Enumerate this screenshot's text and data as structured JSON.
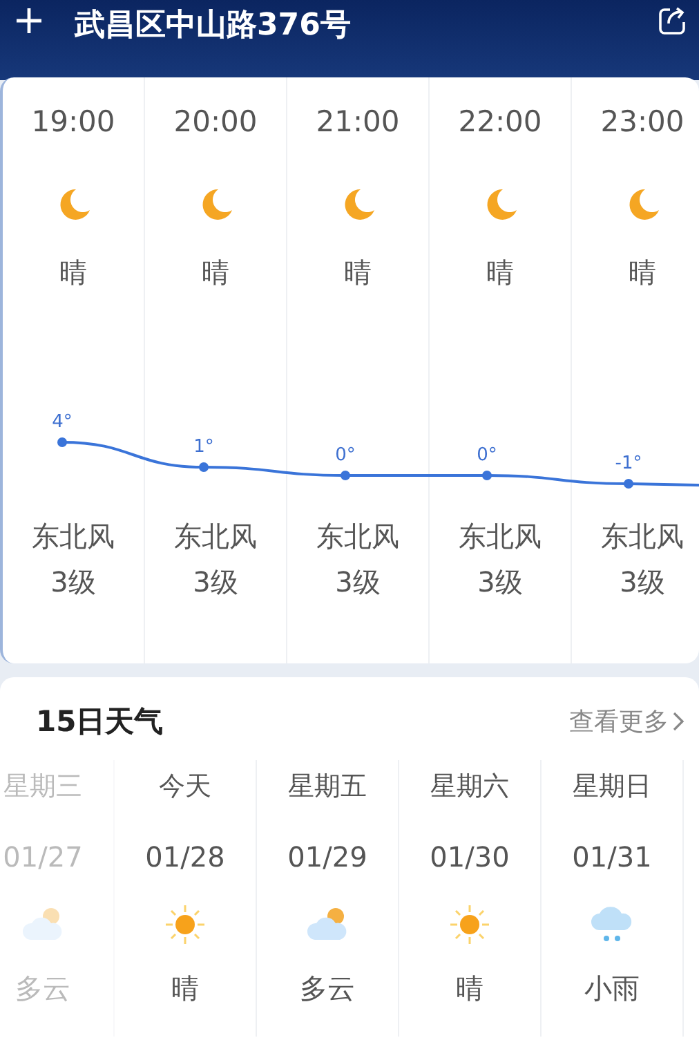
{
  "header": {
    "title": "武昌区中山路376号"
  },
  "hourly": [
    {
      "time": "19:00",
      "kind": "moon",
      "condition": "晴",
      "temp": "4°",
      "wind": "东北风",
      "wind_level": "3级"
    },
    {
      "time": "20:00",
      "kind": "moon",
      "condition": "晴",
      "temp": "1°",
      "wind": "东北风",
      "wind_level": "3级"
    },
    {
      "time": "21:00",
      "kind": "moon",
      "condition": "晴",
      "temp": "0°",
      "wind": "东北风",
      "wind_level": "3级"
    },
    {
      "time": "22:00",
      "kind": "moon",
      "condition": "晴",
      "temp": "0°",
      "wind": "东北风",
      "wind_level": "3级"
    },
    {
      "time": "23:00",
      "kind": "moon",
      "condition": "晴",
      "temp": "-1°",
      "wind": "东北风",
      "wind_level": "3级"
    }
  ],
  "forecast": {
    "title": "15日天气",
    "more": "查看更多",
    "days": [
      {
        "day": "星期三",
        "date": "01/27",
        "kind": "partly-cloudy",
        "condition": "多云",
        "past": true
      },
      {
        "day": "今天",
        "date": "01/28",
        "kind": "sunny",
        "condition": "晴",
        "past": false
      },
      {
        "day": "星期五",
        "date": "01/29",
        "kind": "partly-cloudy",
        "condition": "多云",
        "past": false
      },
      {
        "day": "星期六",
        "date": "01/30",
        "kind": "sunny",
        "condition": "晴",
        "past": false
      },
      {
        "day": "星期日",
        "date": "01/31",
        "kind": "rain",
        "condition": "小雨",
        "past": false
      }
    ]
  }
}
